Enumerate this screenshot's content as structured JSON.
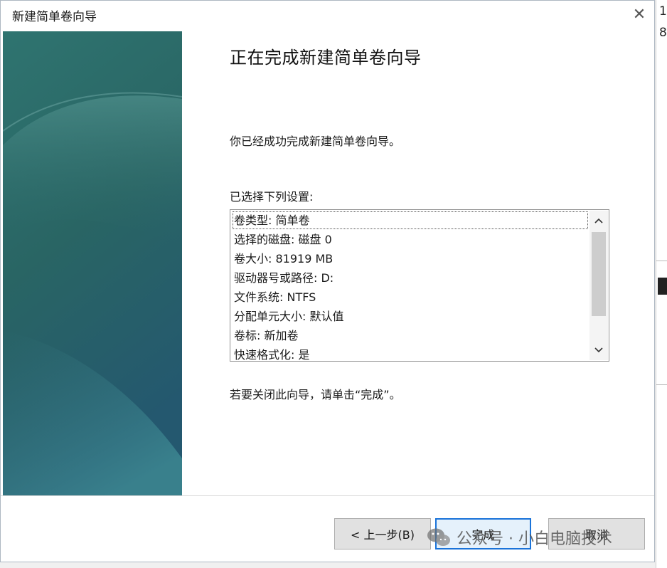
{
  "window": {
    "title": "新建简单卷向导",
    "close_symbol": "✕"
  },
  "page": {
    "heading": "正在完成新建简单卷向导",
    "success_text": "你已经成功完成新建简单卷向导。",
    "settings_label": "已选择下列设置:",
    "settings_items": [
      "卷类型: 简单卷",
      "选择的磁盘: 磁盘 0",
      "卷大小: 81919 MB",
      "驱动器号或路径: D:",
      "文件系统: NTFS",
      "分配单元大小: 默认值",
      "卷标: 新加卷",
      "快速格式化: 是"
    ],
    "close_hint": "若要关闭此向导，请单击“完成”。"
  },
  "buttons": {
    "back": "< 上一步(B)",
    "finish": "完成",
    "cancel": "取消"
  },
  "background_fragments": [
    "1",
    "8"
  ],
  "watermark": {
    "text": "公众号 · 小白电脑技术"
  },
  "colors": {
    "banner_top": "#2c6a6f",
    "banner_bottom": "#245a75",
    "focus_border": "#1a73d9"
  }
}
